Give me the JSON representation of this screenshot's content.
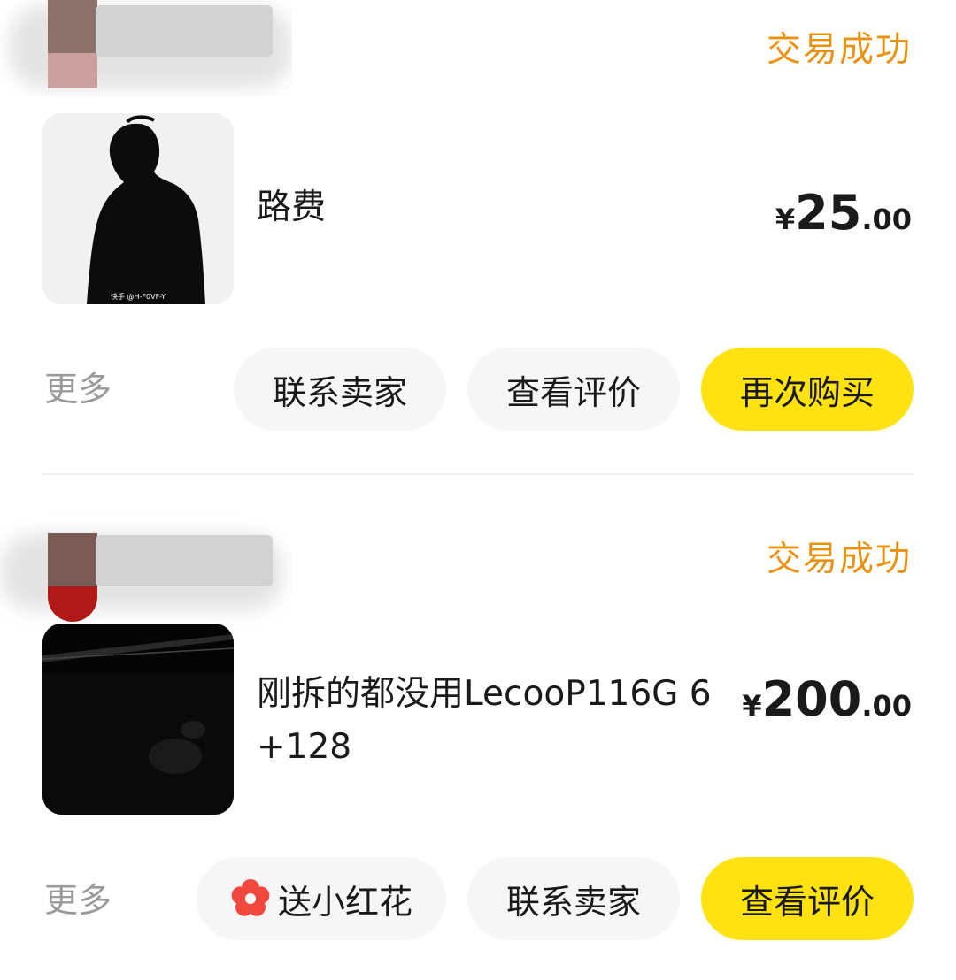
{
  "orders": [
    {
      "status": "交易成功",
      "title": "路费",
      "price": {
        "currency": "¥",
        "integer": "25",
        "decimal": ".00"
      },
      "thumbnail_watermark": "快手 @H-F0VF-Y",
      "more": "更多",
      "buttons": [
        {
          "label": "联系卖家",
          "primary": false
        },
        {
          "label": "查看评价",
          "primary": false
        },
        {
          "label": "再次购买",
          "primary": true
        }
      ]
    },
    {
      "status": "交易成功",
      "title": "刚拆的都没用LecooP116G 6+128",
      "price": {
        "currency": "¥",
        "integer": "200",
        "decimal": ".00"
      },
      "more": "更多",
      "buttons": [
        {
          "label": "送小红花",
          "primary": false,
          "icon": "red-flower-icon"
        },
        {
          "label": "联系卖家",
          "primary": false
        },
        {
          "label": "查看评价",
          "primary": true
        }
      ]
    }
  ],
  "colors": {
    "status": "#e8920f",
    "primary_button": "#ffe20f",
    "secondary_button": "#f6f6f6",
    "muted_text": "#9a9a9a",
    "flower": "#f2493f"
  }
}
